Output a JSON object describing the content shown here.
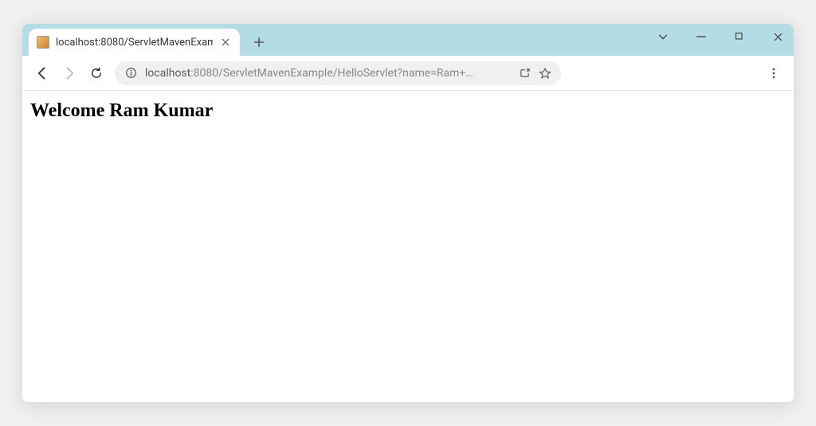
{
  "titlebar": {
    "tab_title": "localhost:8080/ServletMavenExam",
    "window_controls": {
      "minimize": "−",
      "maximize": "□",
      "close": "✕"
    }
  },
  "toolbar": {
    "url_host": "localhost",
    "url_rest": ":8080/ServletMavenExample/HelloServlet?name=Ram+…",
    "url_prefix_display": "localhost"
  },
  "page": {
    "heading": "Welcome Ram Kumar"
  }
}
